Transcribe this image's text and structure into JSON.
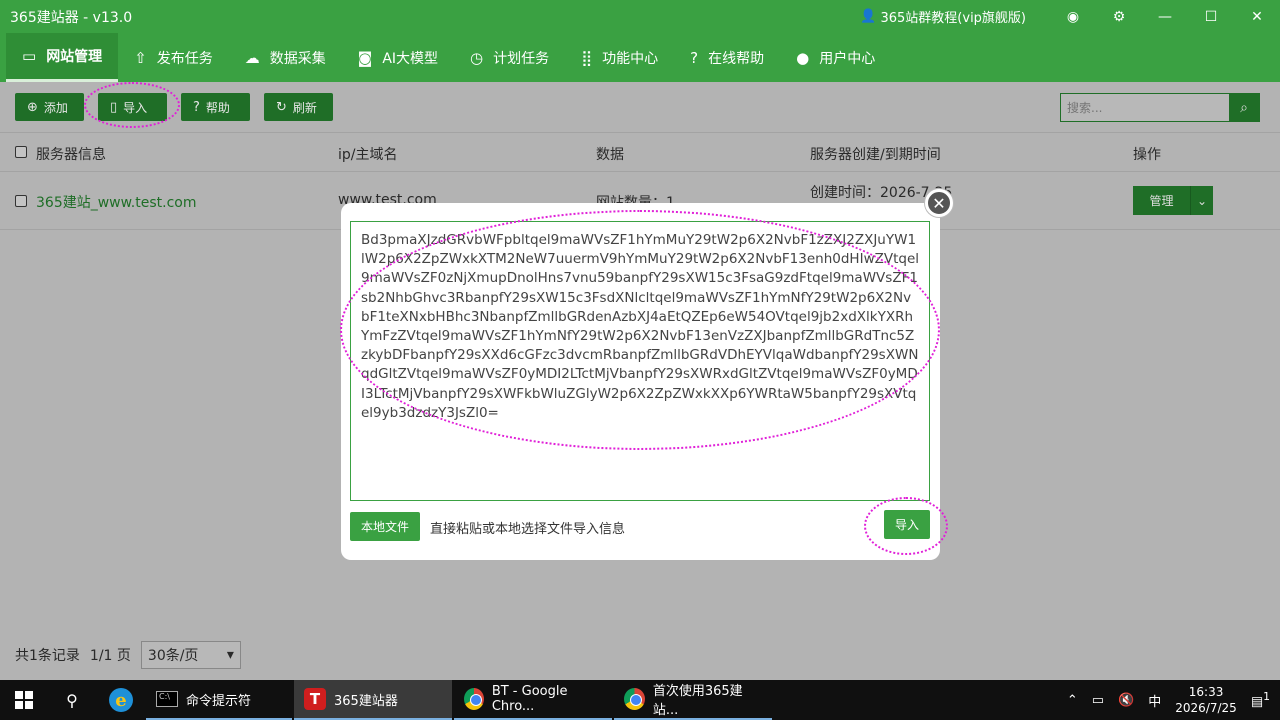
{
  "app": {
    "title": "365建站器 - v13.0",
    "tutorial": "365站群教程(vip旗舰版)"
  },
  "nav": [
    {
      "label": "网站管理",
      "icon": "▭",
      "active": true
    },
    {
      "label": "发布任务",
      "icon": "⇧"
    },
    {
      "label": "数据采集",
      "icon": "☁"
    },
    {
      "label": "AI大模型",
      "icon": "◙"
    },
    {
      "label": "计划任务",
      "icon": "◷"
    },
    {
      "label": "功能中心",
      "icon": "⣿"
    },
    {
      "label": "在线帮助",
      "icon": "?"
    },
    {
      "label": "用户中心",
      "icon": "●"
    }
  ],
  "toolbar": {
    "add": "添加",
    "import": "导入",
    "help": "帮助",
    "refresh": "刷新",
    "search_placeholder": "搜索..."
  },
  "table": {
    "headers": [
      "服务器信息",
      "ip/主域名",
      "数据",
      "服务器创建/到期时间",
      "操作"
    ],
    "row": {
      "name": "365建站_www.test.com",
      "domain": "www.test.com",
      "data": "网站数量：1",
      "created": "创建时间：2026-7-25",
      "action": "管理"
    }
  },
  "footer": {
    "total": "共1条记录",
    "pages": "1/1 页",
    "per_page": "30条/页"
  },
  "modal": {
    "import_text": "Bd3pmaXJzdGRvbWFpbltqel9maWVsZF1hYmMuY29tW2p6X2NvbF1zZXJ2ZXJuYW1lW2p6X2ZpZWxkXTM2NeW7uuermV9hYmMuY29tW2p6X2NvbF13enh0dHIwZVtqel9maWVsZF0zNjXmupDnolHns7vnu59banpfY29sXW15c3FsaG9zdFtqel9maWVsZF1sb2NhbGhvc3RbanpfY29sXW15c3FsdXNlcltqel9maWVsZF1hYmNfY29tW2p6X2NvbF1teXNxbHBhc3NbanpfZmllbGRdenAzbXJ4aEtQZEp6eW54OVtqel9jb2xdXlkYXRhYmFzZVtqel9maWVsZF1hYmNfY29tW2p6X2NvbF13enVzZXJbanpfZmllbGRdTnc5ZzkybDFbanpfY29sXXd6cGFzc3dvcmRbanpfZmllbGRdVDhEYVlqaWdbanpfY29sXWNqdGltZVtqel9maWVsZF0yMDI2LTctMjVbanpfY29sXWRxdGltZVtqel9maWVsZF0yMDI3LTctMjVbanpfY29sXWFkbWluZGlyW2p6X2ZpZWxkXXp6YWRtaW5banpfY29sXVtqel9yb3dzdzY3JsZl0=",
    "local_file": "本地文件",
    "hint": "直接粘贴或本地选择文件导入信息",
    "import": "导入"
  },
  "taskbar": {
    "tasks": [
      "命令提示符",
      "365建站器",
      "BT - Google Chro...",
      "首次使用365建站..."
    ],
    "ime": "中",
    "time": "16:33",
    "date": "2026/7/25",
    "notif": "1"
  }
}
